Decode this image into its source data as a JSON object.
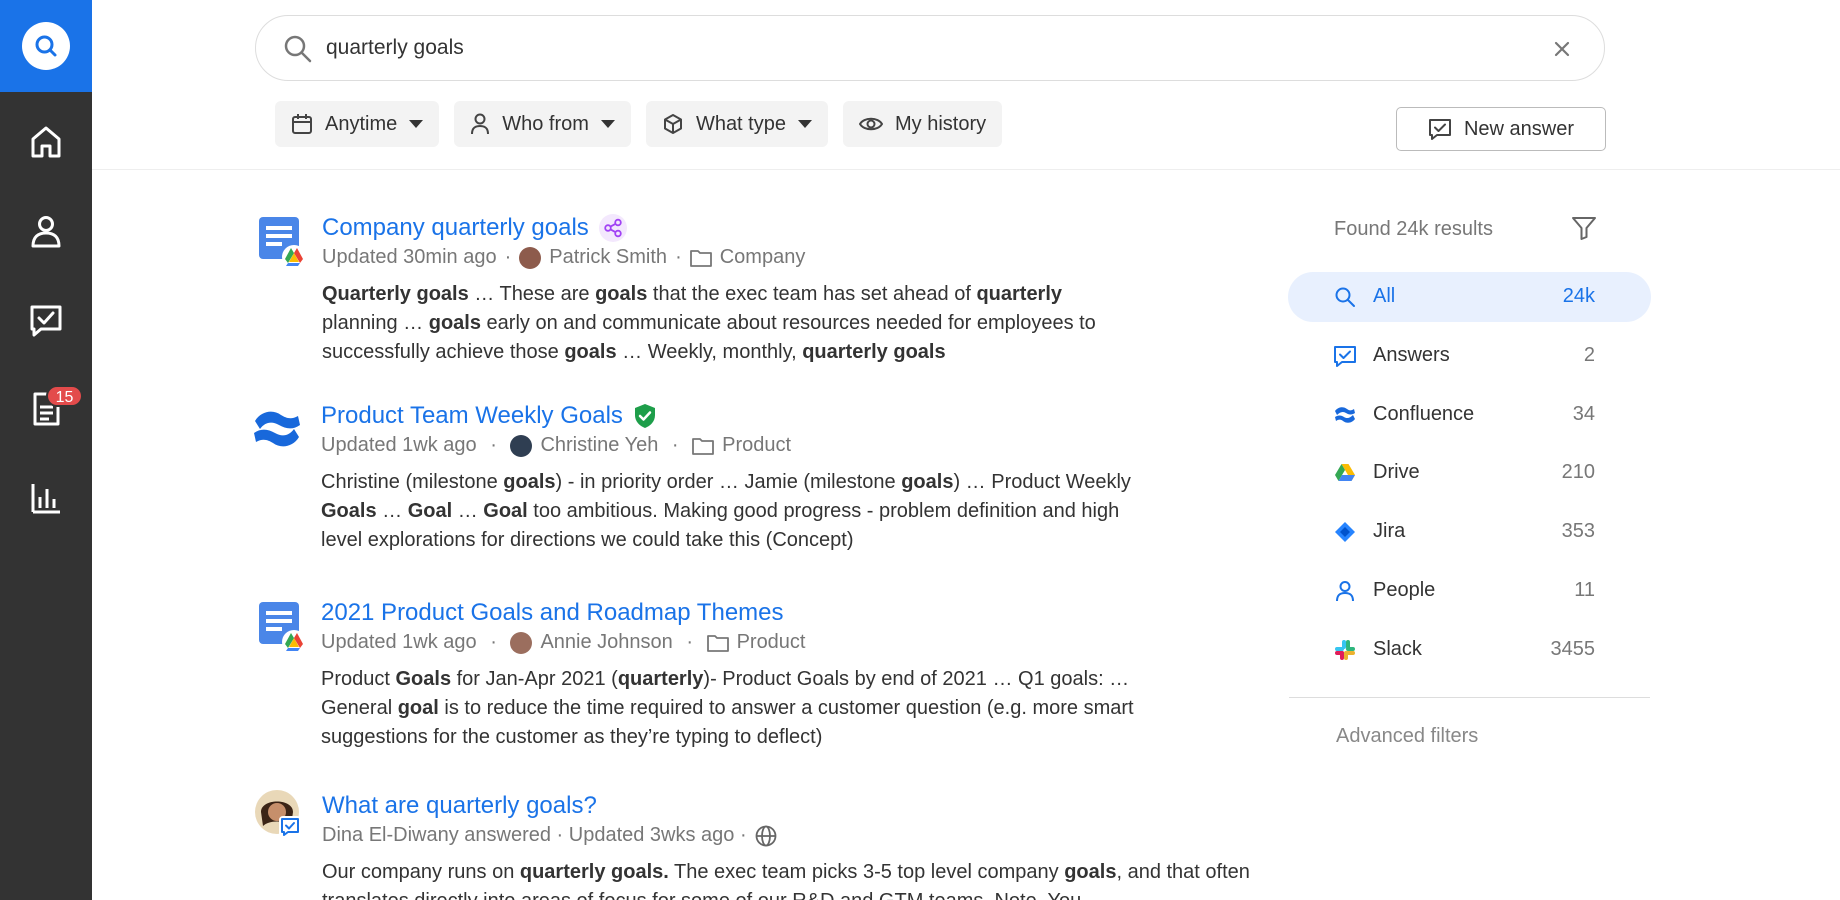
{
  "nav": {
    "items": [
      {
        "name": "home-icon"
      },
      {
        "name": "person-icon"
      },
      {
        "name": "answers-icon"
      },
      {
        "name": "documents-icon",
        "badge": "15"
      },
      {
        "name": "bar-chart-icon"
      }
    ]
  },
  "search": {
    "query": "quarterly goals"
  },
  "filters": {
    "anytime": "Anytime",
    "who_from": "Who from",
    "what_type": "What type",
    "my_history": "My history"
  },
  "new_answer": "New answer",
  "results": [
    {
      "source_icon": "google-docs-drive-icon",
      "title": "Company quarterly goals",
      "title_badge": "share-icon",
      "updated": "Updated 30min ago",
      "author": "Patrick Smith",
      "folder": "Company",
      "snippet_html": "<b>Quarterly goals</b> … These are <b>goals</b> that the exec team has set ahead of <b>quarterly</b> planning … <b>goals</b> early on and communicate about resources needed for employees to successfully achieve those <b>goals</b> … Weekly, monthly, <b>quarterly goals</b>"
    },
    {
      "source_icon": "confluence-icon",
      "title": "Product Team Weekly Goals",
      "title_badge": "verified-shield-icon",
      "updated": "Updated 1wk ago",
      "author": "Christine Yeh",
      "folder": "Product",
      "snippet_html": "Christine (milestone <b>goals</b>) - in priority order … Jamie (milestone <b>goals</b>) … Product Weekly <b>Goals</b> … <b>Goal</b> … <b>Goal</b> too ambitious. Making good progress - problem definition and high level explorations for directions we could take this (Concept)"
    },
    {
      "source_icon": "google-docs-drive-icon",
      "title": "2021 Product Goals and Roadmap Themes",
      "updated": "Updated 1wk ago",
      "author": "Annie Johnson",
      "folder": "Product",
      "snippet_html": "Product <b>Goals</b> for Jan-Apr 2021 (<b>quarterly</b>)- Product Goals by end of 2021 … Q1 goals: … General <b>goal</b> is to reduce the time required to answer a customer question (e.g. more smart suggestions for the customer as they’re typing to deflect)"
    },
    {
      "source_icon": "answer-avatar-icon",
      "title": "What are quarterly goals?",
      "meta": "Dina El-Diwany answered · Updated 3wks ago ·",
      "snippet_html": "Our company runs on <b>quarterly goals.</b> The exec team picks 3-5 top level company <b>goals</b>, and that often translates directly into areas of focus for some of our R&amp;D and GTM teams. Note, You"
    }
  ],
  "panel": {
    "found": "Found 24k results",
    "facets": [
      {
        "icon": "search-icon",
        "name": "All",
        "count": "24k",
        "active": true
      },
      {
        "icon": "answers-icon",
        "name": "Answers",
        "count": "2"
      },
      {
        "icon": "confluence-icon",
        "name": "Confluence",
        "count": "34"
      },
      {
        "icon": "drive-icon",
        "name": "Drive",
        "count": "210"
      },
      {
        "icon": "jira-icon",
        "name": "Jira",
        "count": "353"
      },
      {
        "icon": "person-icon",
        "name": "People",
        "count": "11"
      },
      {
        "icon": "slack-icon",
        "name": "Slack",
        "count": "3455"
      }
    ],
    "advanced": "Advanced filters"
  },
  "colors": {
    "accent": "#1a73e8",
    "rail": "#333333",
    "badge": "#e34b4b"
  }
}
